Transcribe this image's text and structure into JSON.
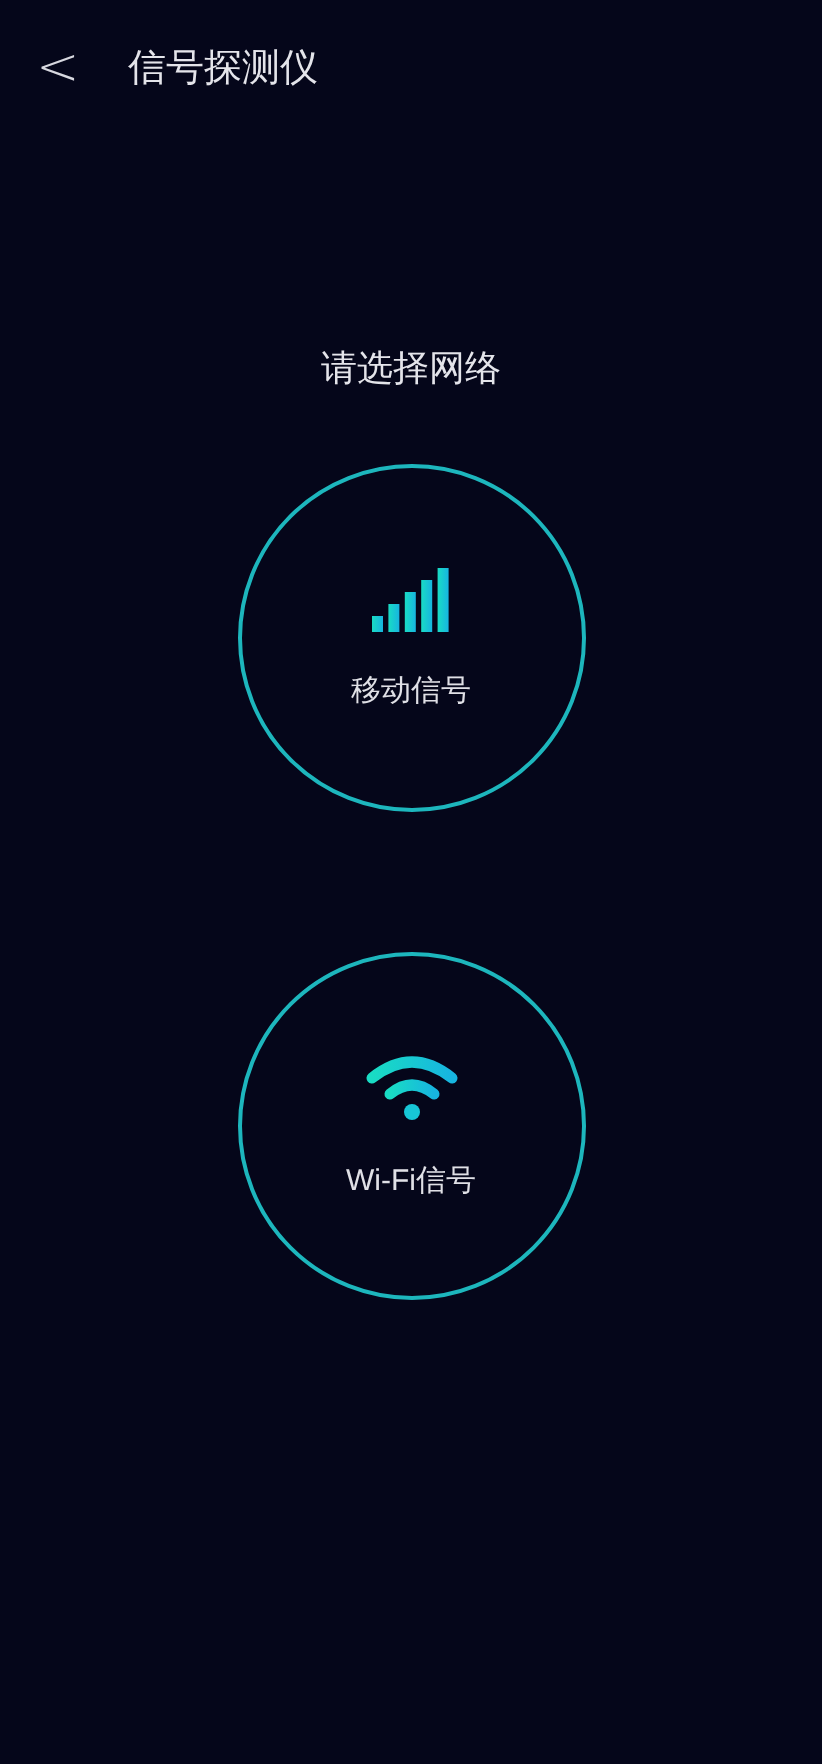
{
  "header": {
    "back": "<",
    "title": "信号探测仪"
  },
  "prompt": "请选择网络",
  "options": [
    {
      "kind": "cellular",
      "label": "移动信号"
    },
    {
      "kind": "wifi",
      "label": "Wi-Fi信号"
    }
  ]
}
